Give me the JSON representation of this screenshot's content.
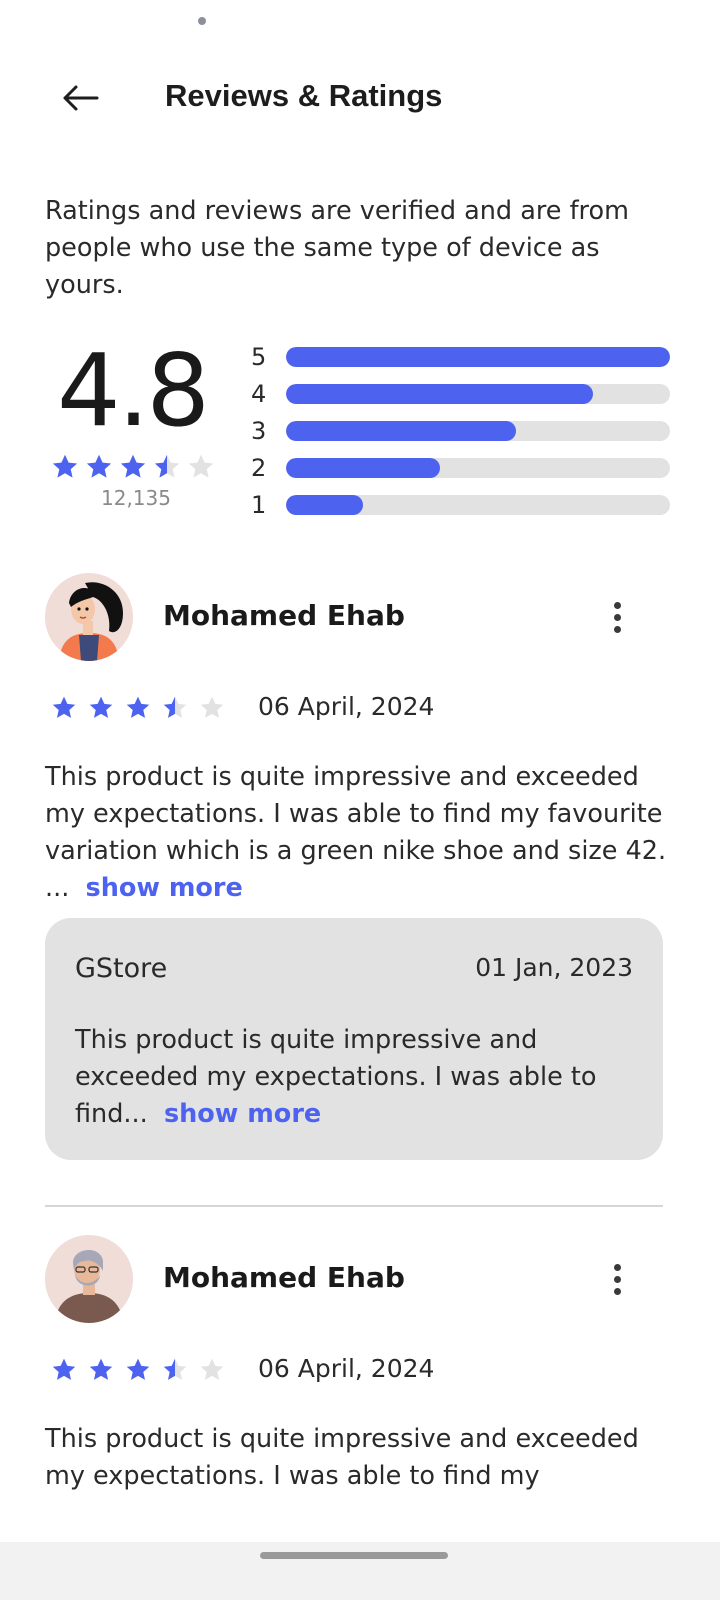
{
  "header": {
    "title": "Reviews & Ratings"
  },
  "intro": "Ratings and reviews are verified and are from people who use the same type of device as yours.",
  "summary": {
    "average": "4.8",
    "count": "12,135",
    "stars": [
      1,
      1,
      1,
      0.5,
      0
    ],
    "bars": [
      {
        "label": "5",
        "fraction": 1.0
      },
      {
        "label": "4",
        "fraction": 0.8
      },
      {
        "label": "3",
        "fraction": 0.6
      },
      {
        "label": "2",
        "fraction": 0.4
      },
      {
        "label": "1",
        "fraction": 0.2
      }
    ]
  },
  "reviews": [
    {
      "name": "Mohamed Ehab",
      "date": "06 April, 2024",
      "stars": [
        1,
        1,
        1,
        0.5,
        0
      ],
      "body": "This product is quite impressive and exceeded my expectations. I was able to find my favourite variation which is a green nike shoe and size 42. ...",
      "show_more": "show more",
      "reply": {
        "store": "GStore",
        "date": "01 Jan, 2023",
        "body": "This product is quite impressive and exceeded my expectations. I was able to find...",
        "show_more": "show more"
      }
    },
    {
      "name": "Mohamed Ehab",
      "date": "06 April, 2024",
      "stars": [
        1,
        1,
        1,
        0.5,
        0
      ],
      "body": "This product is quite impressive and exceeded my expectations. I was able to find my"
    }
  ],
  "colors": {
    "accent": "#4d63f0",
    "empty_star": "#e2e2e2",
    "track": "#e2e2e2"
  },
  "icons": {
    "back": "arrow-left-icon",
    "menu": "more-vertical-icon",
    "star": "star-icon"
  }
}
